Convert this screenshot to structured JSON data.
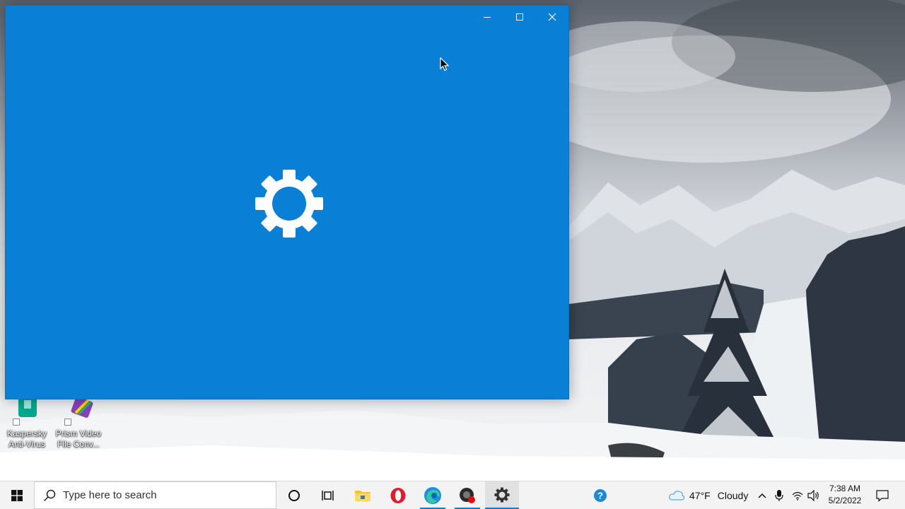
{
  "window": {
    "controls": {
      "minimize": "minimize",
      "maximize": "maximize",
      "close": "close"
    },
    "background_color": "#0a7fd6"
  },
  "desktop_icons": [
    {
      "name": "kaspersky",
      "label": "Kaspersky Anti-Virus",
      "line1": "Kaspersky",
      "line2": "Anti-Virus",
      "icon": "kaspersky-icon"
    },
    {
      "name": "prism",
      "label": "Prism Video File Conv...",
      "line1": "Prism Video",
      "line2": "File Conv...",
      "icon": "prism-icon"
    }
  ],
  "taskbar": {
    "search_placeholder": "Type here to search",
    "apps": [
      {
        "name": "cortana",
        "icon": "cortana-circle-icon"
      },
      {
        "name": "task-view",
        "icon": "task-view-icon"
      },
      {
        "name": "file-explorer",
        "icon": "folder-icon"
      },
      {
        "name": "opera",
        "icon": "opera-icon"
      },
      {
        "name": "edge",
        "icon": "edge-icon"
      },
      {
        "name": "app-record",
        "icon": "recorder-icon"
      },
      {
        "name": "settings",
        "icon": "gear-icon",
        "active": true
      }
    ],
    "weather": {
      "temperature": "47°F",
      "condition": "Cloudy"
    },
    "clock": {
      "time": "7:38 AM",
      "date": "5/2/2022"
    },
    "accent_color": "#0a7fd6"
  }
}
